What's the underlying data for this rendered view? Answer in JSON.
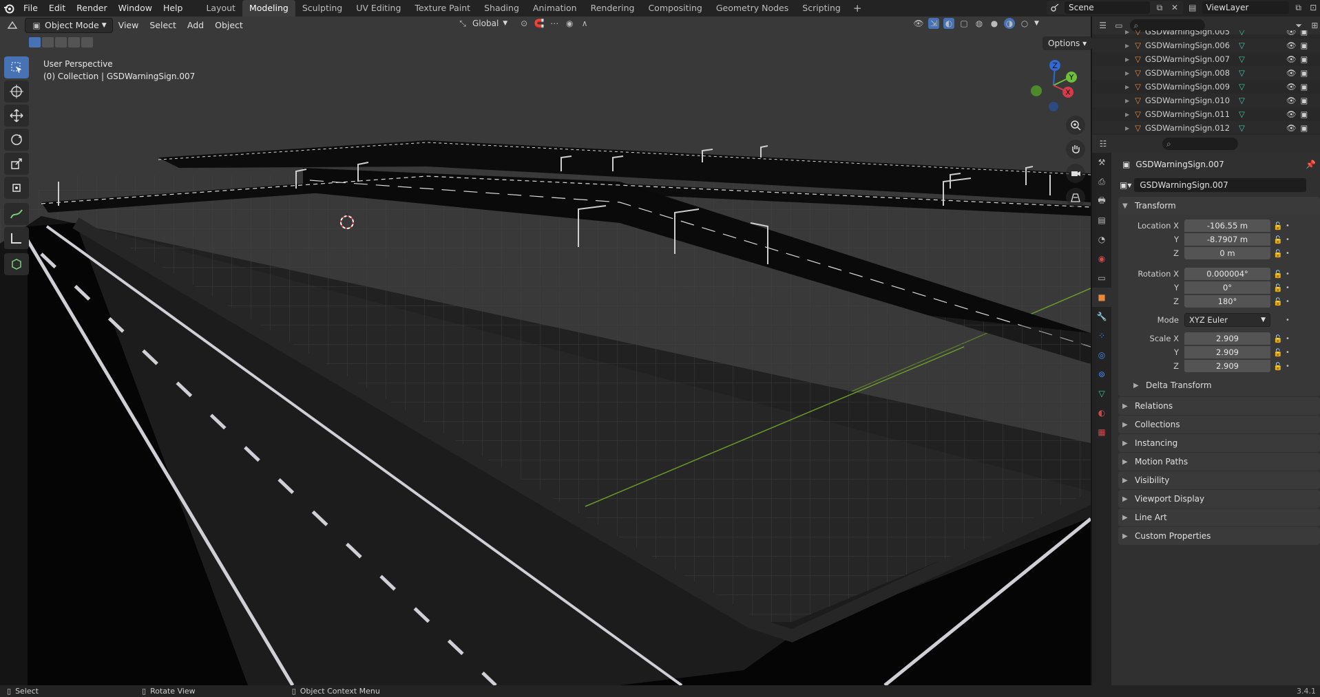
{
  "topbar": {
    "menu": [
      "File",
      "Edit",
      "Render",
      "Window",
      "Help"
    ],
    "workspaces": [
      "Layout",
      "Modeling",
      "Sculpting",
      "UV Editing",
      "Texture Paint",
      "Shading",
      "Animation",
      "Rendering",
      "Compositing",
      "Geometry Nodes",
      "Scripting"
    ],
    "active_workspace": "Modeling",
    "add_tab": "+",
    "scene": "Scene",
    "view_layer": "ViewLayer"
  },
  "viewport": {
    "mode": "Object Mode",
    "menus": [
      "View",
      "Select",
      "Add",
      "Object"
    ],
    "orientation": "Global",
    "options": "Options",
    "perspective": "User Perspective",
    "collection_info": "(0) Collection | GSDWarningSign.007",
    "gizmo": {
      "z": "Z",
      "y": "Y",
      "x": "X"
    }
  },
  "outliner": {
    "rows": [
      {
        "name": "GSDWarningSign.005"
      },
      {
        "name": "GSDWarningSign.006"
      },
      {
        "name": "GSDWarningSign.007"
      },
      {
        "name": "GSDWarningSign.008"
      },
      {
        "name": "GSDWarningSign.009"
      },
      {
        "name": "GSDWarningSign.010"
      },
      {
        "name": "GSDWarningSign.011"
      },
      {
        "name": "GSDWarningSign.012"
      }
    ]
  },
  "properties": {
    "object_title": "GSDWarningSign.007",
    "object_name": "GSDWarningSign.007",
    "transform": {
      "header": "Transform",
      "location_label": "Location X",
      "location": [
        "-106.55 m",
        "-8.7907 m",
        "0 m"
      ],
      "rotation_label": "Rotation X",
      "rotation": [
        "0.000004°",
        "0°",
        "180°"
      ],
      "mode_label": "Mode",
      "mode": "XYZ Euler",
      "scale_label": "Scale X",
      "scale": [
        "2.909",
        "2.909",
        "2.909"
      ],
      "y": "Y",
      "z": "Z",
      "delta": "Delta Transform"
    },
    "panels": [
      "Relations",
      "Collections",
      "Instancing",
      "Motion Paths",
      "Visibility",
      "Viewport Display",
      "Line Art",
      "Custom Properties"
    ]
  },
  "statusbar": {
    "select": "Select",
    "rotate": "Rotate View",
    "context": "Object Context Menu",
    "version": "3.4.1"
  }
}
